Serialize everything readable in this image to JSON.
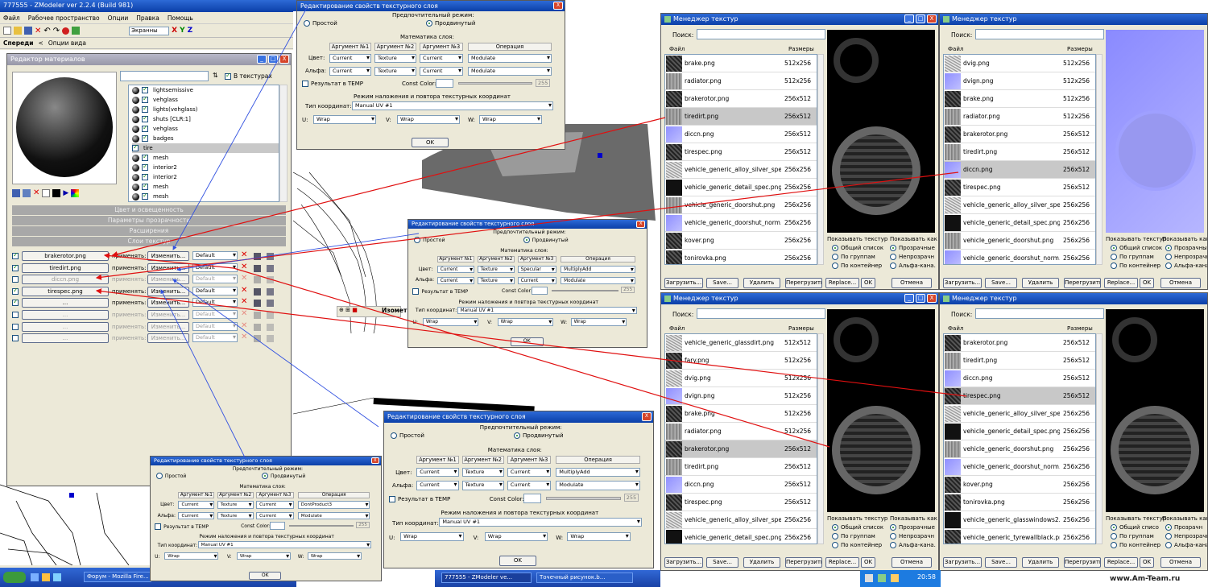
{
  "app": {
    "title": "777555 - ZModeler ver 2.2.4 (Build 981)",
    "menu": [
      "Файл",
      "Рабочее пространство",
      "Опции",
      "Правка",
      "Помощь"
    ],
    "view_dropdown": "Экранны",
    "axes": [
      "X",
      "Y",
      "Z"
    ],
    "tab_front": "Спереди",
    "view_options": "Опции вида",
    "iso_tab": "Изомет",
    "window_controls": [
      "_",
      "□",
      "X"
    ]
  },
  "material_editor": {
    "title": "Редактор материалов",
    "in_textures": "В текстурах",
    "materials": [
      "lightsemissive",
      "vehglass",
      "lights(vehglass)",
      "shuts [CLR:1]",
      "vehglass",
      "badges",
      "tire",
      "mesh",
      "interior2",
      "interior2",
      "mesh",
      "mesh"
    ],
    "selected_material": "tire",
    "sections": [
      "Цвет и освещенность",
      "Параметры прозрачности",
      "Расширения",
      "Слои текстур"
    ],
    "apply_label": "применять:",
    "edit_label": "Изменить...",
    "default_label": "Default",
    "layers": [
      {
        "tex": "brakerotor.png",
        "on": true
      },
      {
        "tex": "tiredirt.png",
        "on": true
      },
      {
        "tex": "diccn.png",
        "on": false
      },
      {
        "tex": "tirespec.png",
        "on": true
      },
      {
        "tex": "...",
        "on": true
      },
      {
        "tex": "...",
        "on": false
      },
      {
        "tex": "...",
        "on": false
      },
      {
        "tex": "...",
        "on": false
      }
    ]
  },
  "texture_dialogs": [
    {
      "title": "Редактирование свойств текстурного слоя",
      "mode_title": "Предпочтительный режим:",
      "simple": "Простой",
      "advanced": "Продвинутый",
      "math_title": "Математика слоя:",
      "col_headers": [
        "Аргумент №1",
        "Аргумент №2",
        "Аргумент №3",
        "Операция"
      ],
      "row_color": "Цвет:",
      "row_alpha": "Альфа:",
      "color_vals": [
        "Current",
        "Texture",
        "Current",
        "Modulate"
      ],
      "alpha_vals": [
        "Current",
        "Texture",
        "Current",
        "Modulate"
      ],
      "temp": "Результат в TEMP",
      "const_color": "Const Color:",
      "const_val": "255",
      "mapping_title": "Режим наложения и повтора текстурных координат",
      "coord_type": "Тип координат:",
      "coord_val": "Manual UV #1",
      "u": "U:",
      "v": "V:",
      "w": "W:",
      "wrap": "Wrap",
      "ok": "OK"
    },
    {
      "title": "Редактирование свойств текстурного слоя",
      "mode_title": "Предпочтительный режим:",
      "simple": "Простой",
      "advanced": "Продвинутый",
      "math_title": "Математика слоя:",
      "col_headers": [
        "Аргумент №1",
        "Аргумент №2",
        "Аргумент №3",
        "Операция"
      ],
      "row_color": "Цвет:",
      "row_alpha": "Альфа:",
      "color_vals": [
        "Current",
        "Texture",
        "Specular",
        "MultiplyAdd"
      ],
      "alpha_vals": [
        "Current",
        "Texture",
        "Current",
        "Modulate"
      ],
      "temp": "Результат в TEMP",
      "const_color": "Const Color:",
      "const_val": "255",
      "mapping_title": "Режим наложения и повтора текстурных координат",
      "coord_type": "Тип координат:",
      "coord_val": "Manual UV #1",
      "u": "U:",
      "v": "V:",
      "w": "W:",
      "wrap": "Wrap",
      "ok": "OK"
    },
    {
      "title": "Редактирование свойств текстурного слоя",
      "mode_title": "Предпочтительный режим:",
      "simple": "Простой",
      "advanced": "Продвинутый",
      "math_title": "Математика слоя:",
      "col_headers": [
        "Аргумент №1",
        "Аргумент №2",
        "Аргумент №3",
        "Операция"
      ],
      "row_color": "Цвет:",
      "row_alpha": "Альфа:",
      "color_vals": [
        "Current",
        "Texture",
        "Current",
        "MultiplyAdd"
      ],
      "alpha_vals": [
        "Current",
        "Texture",
        "Current",
        "Modulate"
      ],
      "temp": "Результат в TEMP",
      "const_color": "Const Color:",
      "const_val": "255",
      "mapping_title": "Режим наложения и повтора текстурных координат",
      "coord_type": "Тип координат:",
      "coord_val": "Manual UV #1",
      "u": "U:",
      "v": "V:",
      "w": "W:",
      "wrap": "Wrap",
      "ok": "OK"
    },
    {
      "title": "Редактирование свойств текстурного слоя",
      "mode_title": "Предпочтительный режим:",
      "simple": "Простой",
      "advanced": "Продвинутый",
      "math_title": "Математика слоя:",
      "col_headers": [
        "Аргумент №1",
        "Аргумент №2",
        "Аргумент №3",
        "Операция"
      ],
      "row_color": "Цвет:",
      "row_alpha": "Альфа:",
      "color_vals": [
        "Current",
        "Texture",
        "Current",
        "DontProduct3"
      ],
      "alpha_vals": [
        "Current",
        "Texture",
        "Current",
        "Modulate"
      ],
      "temp": "Результат в TEMP",
      "const_color": "Const Color:",
      "const_val": "255",
      "mapping_title": "Режим наложения и повтора текстурных координат",
      "coord_type": "Тип координат:",
      "coord_val": "Manual UV #1",
      "u": "U:",
      "v": "V:",
      "w": "W:",
      "wrap": "Wrap",
      "ok": "OK"
    }
  ],
  "texture_managers": [
    {
      "title": "Менеджер текстур",
      "search": "Поиск:",
      "col_file": "Файл",
      "col_size": "Размеры",
      "files": [
        [
          "brake.png",
          "512x256",
          "tex-dark"
        ],
        [
          "radiator.png",
          "512x256",
          "tex-gray"
        ],
        [
          "brakerotor.png",
          "256x512",
          "tex-dark"
        ],
        [
          "tiredirt.png",
          "256x512",
          "tex-gray"
        ],
        [
          "diccn.png",
          "256x512",
          "tex-blue"
        ],
        [
          "tirespec.png",
          "256x512",
          "tex-dark"
        ],
        [
          "vehicle_generic_alloy_silver_spe...",
          "256x256",
          "tex-noise"
        ],
        [
          "vehicle_generic_detail_spec.png",
          "256x256",
          "tex-black"
        ],
        [
          "vehicle_generic_doorshut.png",
          "256x256",
          "tex-gray"
        ],
        [
          "vehicle_generic_doorshut_norm...",
          "256x256",
          "tex-blue"
        ],
        [
          "kover.png",
          "256x256",
          "tex-dark"
        ],
        [
          "tonirovka.png",
          "256x256",
          "tex-dark"
        ]
      ],
      "selected": 3,
      "preview": "black",
      "show_tex": "Показывать текстур",
      "show_as": "Показывать как",
      "opt_a": [
        "Общий список",
        "По группам",
        "По контейнер"
      ],
      "opt_b": [
        "Прозрачные",
        "Непрозрачн",
        "Альфа-кана."
      ],
      "buttons": [
        "Загрузить...",
        "Save...",
        "Удалить",
        "Перегрузить",
        "Replace..."
      ],
      "ok": "OK",
      "cancel": "Отмена"
    },
    {
      "title": "Менеджер текстур",
      "search": "Поиск:",
      "col_file": "Файл",
      "col_size": "Размеры",
      "files": [
        [
          "dvig.png",
          "512x256",
          "tex-noise"
        ],
        [
          "dvign.png",
          "512x256",
          "tex-blue"
        ],
        [
          "brake.png",
          "512x256",
          "tex-dark"
        ],
        [
          "radiator.png",
          "512x256",
          "tex-gray"
        ],
        [
          "brakerotor.png",
          "256x512",
          "tex-dark"
        ],
        [
          "tiredirt.png",
          "256x512",
          "tex-gray"
        ],
        [
          "diccn.png",
          "256x512",
          "tex-blue"
        ],
        [
          "tirespec.png",
          "256x512",
          "tex-dark"
        ],
        [
          "vehicle_generic_alloy_silver_spe...",
          "256x256",
          "tex-noise"
        ],
        [
          "vehicle_generic_detail_spec.png",
          "256x256",
          "tex-black"
        ],
        [
          "vehicle_generic_doorshut.png",
          "256x256",
          "tex-gray"
        ],
        [
          "vehicle_generic_doorshut_norm...",
          "256x256",
          "tex-blue"
        ]
      ],
      "selected": 6,
      "preview": "blue",
      "show_tex": "Показывать текстур",
      "show_as": "Показывать как",
      "opt_a": [
        "Общий список",
        "По группам",
        "По контейнер"
      ],
      "opt_b": [
        "Прозрачные",
        "Непрозрачн",
        "Альфа-кана."
      ],
      "buttons": [
        "Загрузить...",
        "Save...",
        "Удалить",
        "Перегрузить",
        "Replace..."
      ],
      "ok": "OK",
      "cancel": "Отмена"
    },
    {
      "title": "Менеджер текстур",
      "search": "Поиск:",
      "col_file": "Файл",
      "col_size": "Размеры",
      "files": [
        [
          "vehicle_generic_glassdirt.png",
          "512x512",
          "tex-noise"
        ],
        [
          "fary.png",
          "512x256",
          "tex-dark"
        ],
        [
          "dvig.png",
          "512x256",
          "tex-noise"
        ],
        [
          "dvign.png",
          "512x256",
          "tex-blue"
        ],
        [
          "brake.png",
          "512x256",
          "tex-dark"
        ],
        [
          "radiator.png",
          "512x256",
          "tex-gray"
        ],
        [
          "brakerotor.png",
          "256x512",
          "tex-dark"
        ],
        [
          "tiredirt.png",
          "256x512",
          "tex-gray"
        ],
        [
          "diccn.png",
          "256x512",
          "tex-blue"
        ],
        [
          "tirespec.png",
          "256x512",
          "tex-dark"
        ],
        [
          "vehicle_generic_alloy_silver_spe...",
          "256x256",
          "tex-noise"
        ],
        [
          "vehicle_generic_detail_spec.png",
          "256x256",
          "tex-black"
        ]
      ],
      "selected": 6,
      "preview": "black2",
      "show_tex": "Показывать текстур",
      "show_as": "Показывать как",
      "opt_a": [
        "Общий список",
        "По группам",
        "По контейнер"
      ],
      "opt_b": [
        "Прозрачные",
        "Непрозрачн",
        "Альфа-кана."
      ],
      "buttons": [
        "Загрузить...",
        "Save...",
        "Удалить",
        "Перегрузить",
        "Replace..."
      ],
      "ok": "OK",
      "cancel": "Отмена"
    },
    {
      "title": "Менеджер текстур",
      "search": "Поиск:",
      "col_file": "Файл",
      "col_size": "Размеры",
      "files": [
        [
          "brakerotor.png",
          "256x512",
          "tex-dark"
        ],
        [
          "tiredirt.png",
          "256x512",
          "tex-gray"
        ],
        [
          "diccn.png",
          "256x512",
          "tex-blue"
        ],
        [
          "tirespec.png",
          "256x512",
          "tex-dark"
        ],
        [
          "vehicle_generic_alloy_silver_spe...",
          "256x256",
          "tex-noise"
        ],
        [
          "vehicle_generic_detail_spec.png",
          "256x256",
          "tex-black"
        ],
        [
          "vehicle_generic_doorshut.png",
          "256x256",
          "tex-gray"
        ],
        [
          "vehicle_generic_doorshut_norm...",
          "256x256",
          "tex-blue"
        ],
        [
          "kover.png",
          "256x256",
          "tex-dark"
        ],
        [
          "tonirovka.png",
          "256x256",
          "tex-dark"
        ],
        [
          "vehicle_generic_glasswindows2....",
          "256x256",
          "tex-black"
        ],
        [
          "vehicle_generic_tyrewallblack.png",
          "256x256",
          "tex-dark"
        ]
      ],
      "selected": 3,
      "preview": "black3",
      "show_tex": "Показывать текстур",
      "show_as": "Показывать как",
      "opt_a": [
        "Общий списо",
        "По группам",
        "По контейнер"
      ],
      "opt_b": [
        "Прозрачн",
        "Непрозрачн",
        "Альфа-кана"
      ],
      "buttons": [
        "Загрузить...",
        "Save...",
        "Удалить",
        "Перегрузить",
        "Replace..."
      ],
      "ok": "OK",
      "cancel": "Отмена"
    }
  ],
  "taskbar": {
    "items": [
      "Форум - Mozilla Fire...",
      "777555 - ZModeler ve...",
      "Точечный рисунок.b..."
    ],
    "clock": "20:58"
  },
  "watermark": "www.Am-Team.ru",
  "colors": {
    "arrow_red": "#e01010",
    "arrow_blue": "#3050e0",
    "title_blue": "#0b3fa8"
  }
}
